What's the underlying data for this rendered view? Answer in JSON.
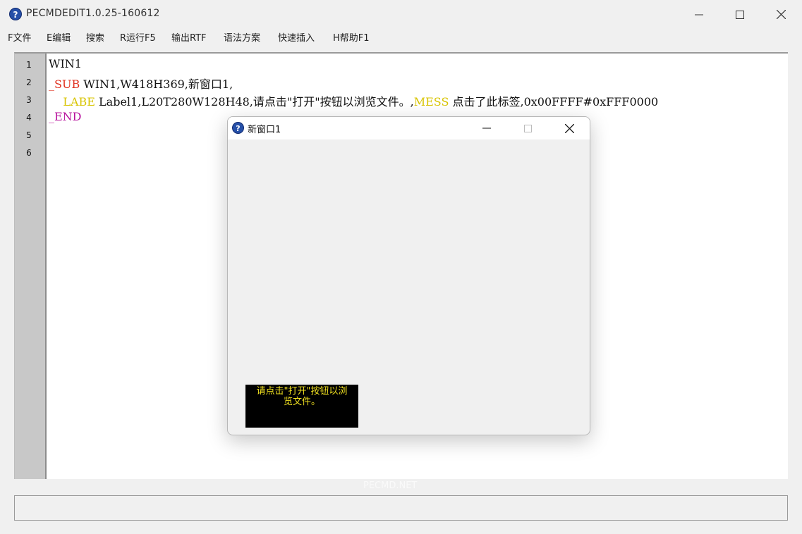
{
  "window": {
    "title": "PECMDEDIT1.0.25-160612",
    "icon": "help-question-icon"
  },
  "menu": [
    "F文件",
    "E编辑",
    "搜索",
    "R运行F5",
    "输出RTF",
    "语法方案",
    "快速插入",
    "H帮助F1"
  ],
  "editor": {
    "line_numbers": [
      "1",
      "2",
      "3",
      "4",
      "5",
      "6"
    ],
    "lines": {
      "l1": "WIN1",
      "l2_kw": "_SUB",
      "l2_rest": " WIN1,W418H369,新窗口1,",
      "l3_indent": "    ",
      "l3_kw": "LABE",
      "l3_mid": " Label1,L20T280W128H48,请点击\"打开\"按钮以浏览文件。,",
      "l3_kw2": "MESS",
      "l3_rest": " 点击了此标签,0x00FFFF#0xFFF0000",
      "l4_kw": "_END"
    },
    "colors": {
      "keyword_red": "#e0301e",
      "keyword_yellow": "#d8c400",
      "keyword_magenta": "#b8149e"
    }
  },
  "watermark": "PECMD.NET",
  "child_window": {
    "title": "新窗口1",
    "icon": "help-question-icon",
    "label": {
      "line1": "请点击\"打开\"按钮以浏",
      "line2": "览文件。",
      "bg_color": "#000000",
      "text_color": "#f0e020"
    }
  }
}
